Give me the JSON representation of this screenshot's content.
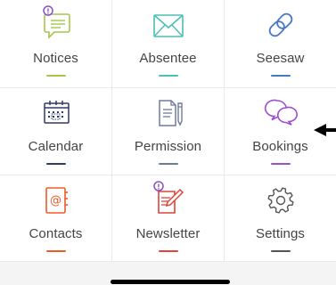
{
  "colors": {
    "top_bar": "#c0233a",
    "notices": "#a6c64a",
    "absentee": "#4cc0b4",
    "seesaw": "#4a78c4",
    "calendar": "#2f3a6a",
    "permission": "#6f7b9c",
    "bookings": "#9b4fd0",
    "contacts": "#f05a28",
    "newsletter": "#e2433a",
    "settings": "#555555",
    "pointer": "#000000",
    "home_indicator": "#000000"
  },
  "grid": {
    "items": [
      {
        "label": "Notices",
        "icon": "notice-speech-bubble-icon",
        "underline": "#a6c64a",
        "badge": "!"
      },
      {
        "label": "Absentee",
        "icon": "envelope-icon",
        "underline": "#4cc0b4"
      },
      {
        "label": "Seesaw",
        "icon": "chain-link-icon",
        "underline": "#4a78c4"
      },
      {
        "label": "Calendar",
        "icon": "calendar-icon",
        "underline": "#2f3a6a"
      },
      {
        "label": "Permission",
        "icon": "document-pen-icon",
        "underline": "#6f7b9c"
      },
      {
        "label": "Bookings",
        "icon": "chat-bubbles-icon",
        "underline": "#9b4fd0"
      },
      {
        "label": "Contacts",
        "icon": "address-book-icon",
        "underline": "#f05a28"
      },
      {
        "label": "Newsletter",
        "icon": "newsletter-edit-icon",
        "underline": "#e2433a",
        "badge": "!"
      },
      {
        "label": "Settings",
        "icon": "gear-icon",
        "underline": "#555555"
      }
    ]
  }
}
